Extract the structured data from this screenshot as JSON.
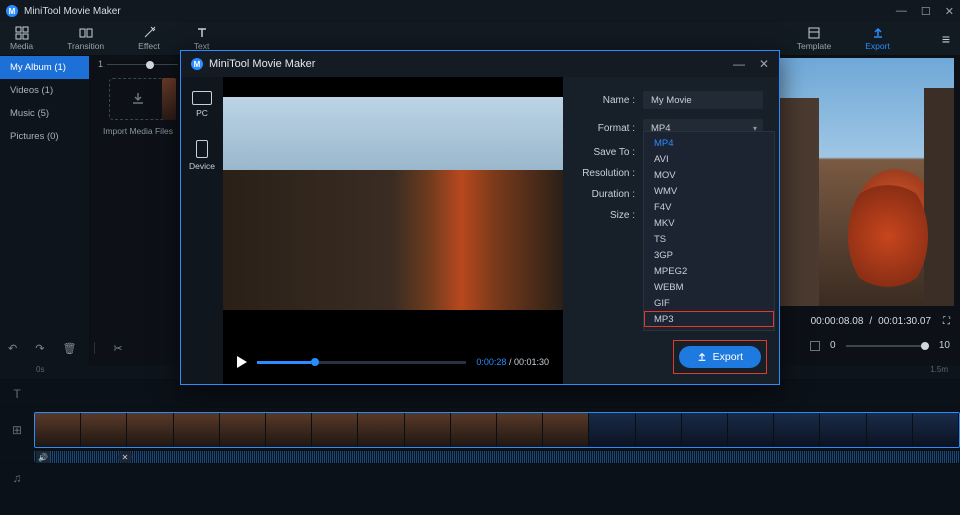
{
  "app": {
    "title": "MiniTool Movie Maker"
  },
  "toolbar": {
    "media": "Media",
    "transition": "Transition",
    "effect": "Effect",
    "text": "Text",
    "template": "Template",
    "export": "Export"
  },
  "sidebar": {
    "items": [
      {
        "label": "My Album (1)",
        "active": true
      },
      {
        "label": "Videos (1)"
      },
      {
        "label": "Music (5)"
      },
      {
        "label": "Pictures (0)"
      }
    ]
  },
  "mediapanel": {
    "import_label": "Import Media Files"
  },
  "zoom": {
    "min": "1",
    "max": ""
  },
  "preview": {
    "current": "00:00:08.08",
    "total": "00:01:30.07",
    "vol_label": "0",
    "vol_value": "10"
  },
  "timeline": {
    "ruler_start": "0s",
    "ruler_end": "1.5m",
    "text_track": "T",
    "video_track": "⊞",
    "audio_track": "♫"
  },
  "dialog": {
    "title": "MiniTool Movie Maker",
    "side": {
      "pc": "PC",
      "device": "Device"
    },
    "player": {
      "current": "0:00:28",
      "total": "00:01:30"
    },
    "form": {
      "name_label": "Name :",
      "name_value": "My Movie",
      "format_label": "Format :",
      "format_value": "MP4",
      "saveto_label": "Save To :",
      "resolution_label": "Resolution :",
      "duration_label": "Duration :",
      "size_label": "Size :"
    },
    "format_options": [
      "MP4",
      "AVI",
      "MOV",
      "WMV",
      "F4V",
      "MKV",
      "TS",
      "3GP",
      "MPEG2",
      "WEBM",
      "GIF",
      "MP3"
    ],
    "export_label": "Export"
  }
}
